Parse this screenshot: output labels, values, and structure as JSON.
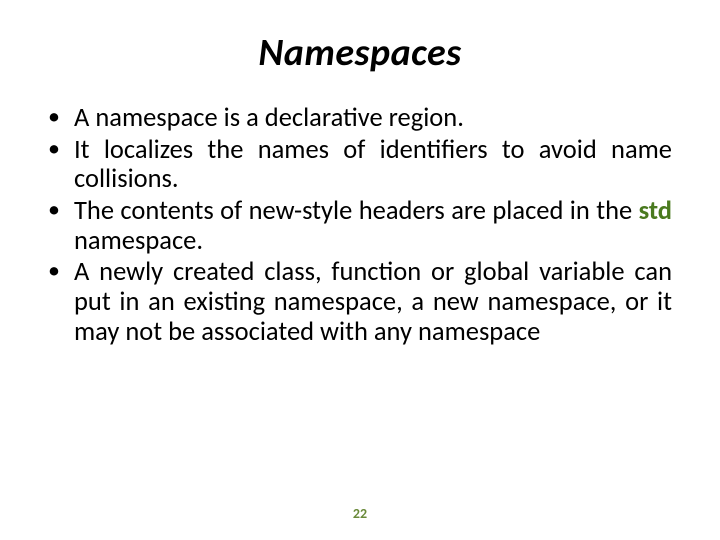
{
  "title": "Namespaces",
  "bullets": [
    {
      "text": "A namespace is a declarative region."
    },
    {
      "text": "It localizes the names of identifiers to avoid name collisions."
    },
    {
      "prefix": "The contents of new-style headers are placed in the ",
      "keyword": "std",
      "suffix": " namespace."
    },
    {
      "text": "A newly created class, function or global variable can put in an existing namespace, a new namespace, or it may not be associated with any namespace"
    }
  ],
  "page_number": "22",
  "colors": {
    "keyword": "#4a7a1f",
    "page_number": "#6a8a3a"
  }
}
